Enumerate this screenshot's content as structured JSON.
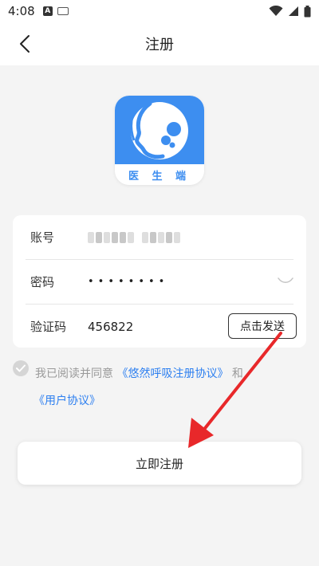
{
  "status_bar": {
    "time": "4:08",
    "a_icon": "A"
  },
  "nav": {
    "title": "注册"
  },
  "logo": {
    "caption": "医 生 端"
  },
  "form": {
    "account_label": "账号",
    "password_label": "密码",
    "password_value": "••••••••",
    "code_label": "验证码",
    "code_value": "456822",
    "send_code_label": "点击发送"
  },
  "agreement": {
    "prefix": "我已阅读并同意 ",
    "link1": "《悠然呼吸注册协议》",
    "connector": "和",
    "link2": "《用户协议》"
  },
  "register_button": {
    "label": "立即注册"
  },
  "colors": {
    "accent": "#3d8ef0",
    "link": "#2d7ff0",
    "annotation_arrow": "#e8282a"
  }
}
